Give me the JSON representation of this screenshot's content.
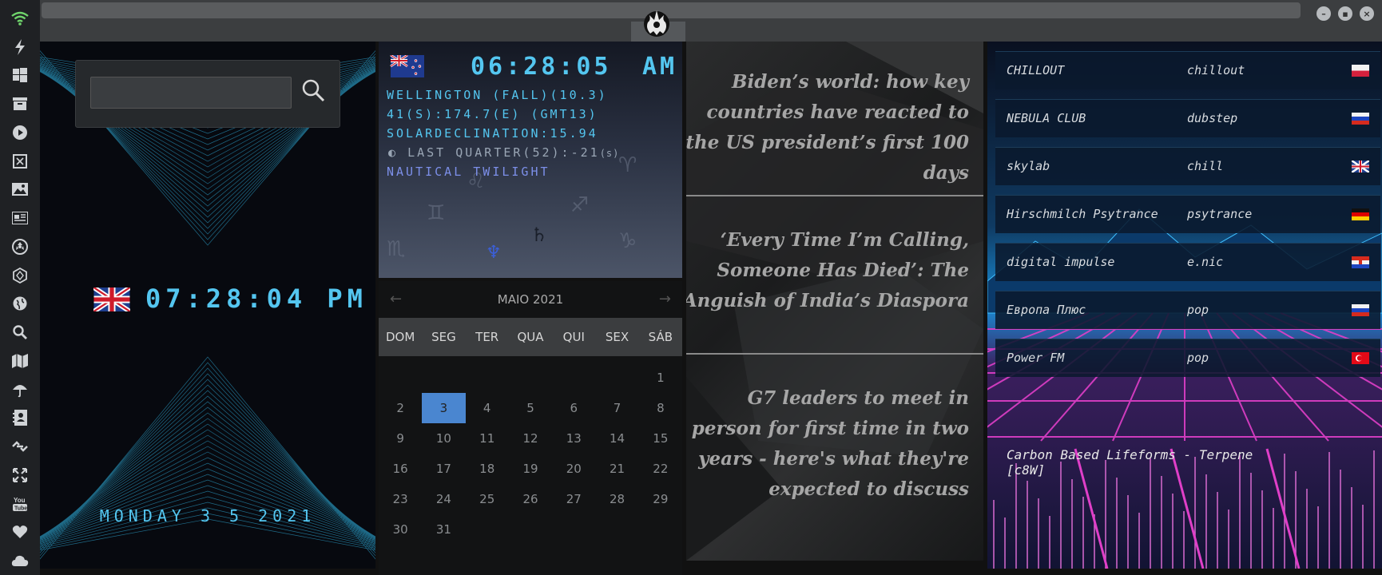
{
  "sidebar": {
    "icons": [
      "wifi-icon",
      "power-icon",
      "windows-icon",
      "archive-icon",
      "play-icon",
      "book-icon",
      "image-icon",
      "news-icon",
      "radiation-icon",
      "hexagon-icon",
      "globe-icon",
      "search-icon",
      "map-icon",
      "umbrella-icon",
      "contacts-icon",
      "link-icon",
      "expand-icon",
      "youtube-icon",
      "heart-icon",
      "cloud-icon"
    ]
  },
  "titlebar": {
    "minimize": "–",
    "maximize": "▪",
    "close": "×"
  },
  "clock": {
    "search_placeholder": "",
    "local_time": "07:28:04 PM",
    "local_date": "MONDAY 3 5 2021"
  },
  "astro": {
    "time": "06:28:05",
    "ampm": "AM",
    "line1": "WELLINGTON (FALL)(10.3)",
    "line2": "41(S):174.7(E) (GMT13)",
    "line3": "SOLARDECLINATION:15.94",
    "line4": "LAST QUARTER(52):-21",
    "line4_unit": "(s)",
    "line5": "NAUTICAL TWILIGHT",
    "saturn": "♄",
    "neptune": "♆"
  },
  "calendar": {
    "month": "MAIO 2021",
    "prev": "←",
    "next": "→",
    "weekdays": [
      "DOM",
      "SEG",
      "TER",
      "QUA",
      "QUI",
      "SEX",
      "SÁB"
    ],
    "days": [
      "",
      "",
      "",
      "",
      "",
      "",
      "1",
      "2",
      "3",
      "4",
      "5",
      "6",
      "7",
      "8",
      "9",
      "10",
      "11",
      "12",
      "13",
      "14",
      "15",
      "16",
      "17",
      "18",
      "19",
      "20",
      "21",
      "22",
      "23",
      "24",
      "25",
      "26",
      "27",
      "28",
      "29",
      "30",
      "31"
    ],
    "today": "3"
  },
  "news": {
    "items": [
      "Biden’s world: how key countries have reacted to the US president’s first 100 days",
      "‘Every Time I’m Calling, Someone Has Died’: The Anguish of India’s Diaspora",
      "G7 leaders to meet in person for first time in two years - here's what they're expected to discuss"
    ]
  },
  "radio": {
    "stations": [
      {
        "name": "CHILLOUT",
        "genre": "chillout",
        "flag": "pl"
      },
      {
        "name": "NEBULA CLUB",
        "genre": "dubstep",
        "flag": "ru"
      },
      {
        "name": "skylab",
        "genre": "chill",
        "flag": "uk"
      },
      {
        "name": "Hirschmilch Psytrance",
        "genre": "psytrance",
        "flag": "de"
      },
      {
        "name": "digital impulse",
        "genre": "e.nic",
        "flag": "hr"
      },
      {
        "name": "Европа Плюс",
        "genre": "pop",
        "flag": "ru"
      },
      {
        "name": "Power FM",
        "genre": "pop",
        "flag": "tr"
      }
    ],
    "now_playing": "Carbon Based Lifeforms - Terpene [c8W]"
  },
  "colors": {
    "accent": "#54c6f0",
    "calendar_today": "#4a86d0",
    "twilight": "#7c8fe8"
  }
}
